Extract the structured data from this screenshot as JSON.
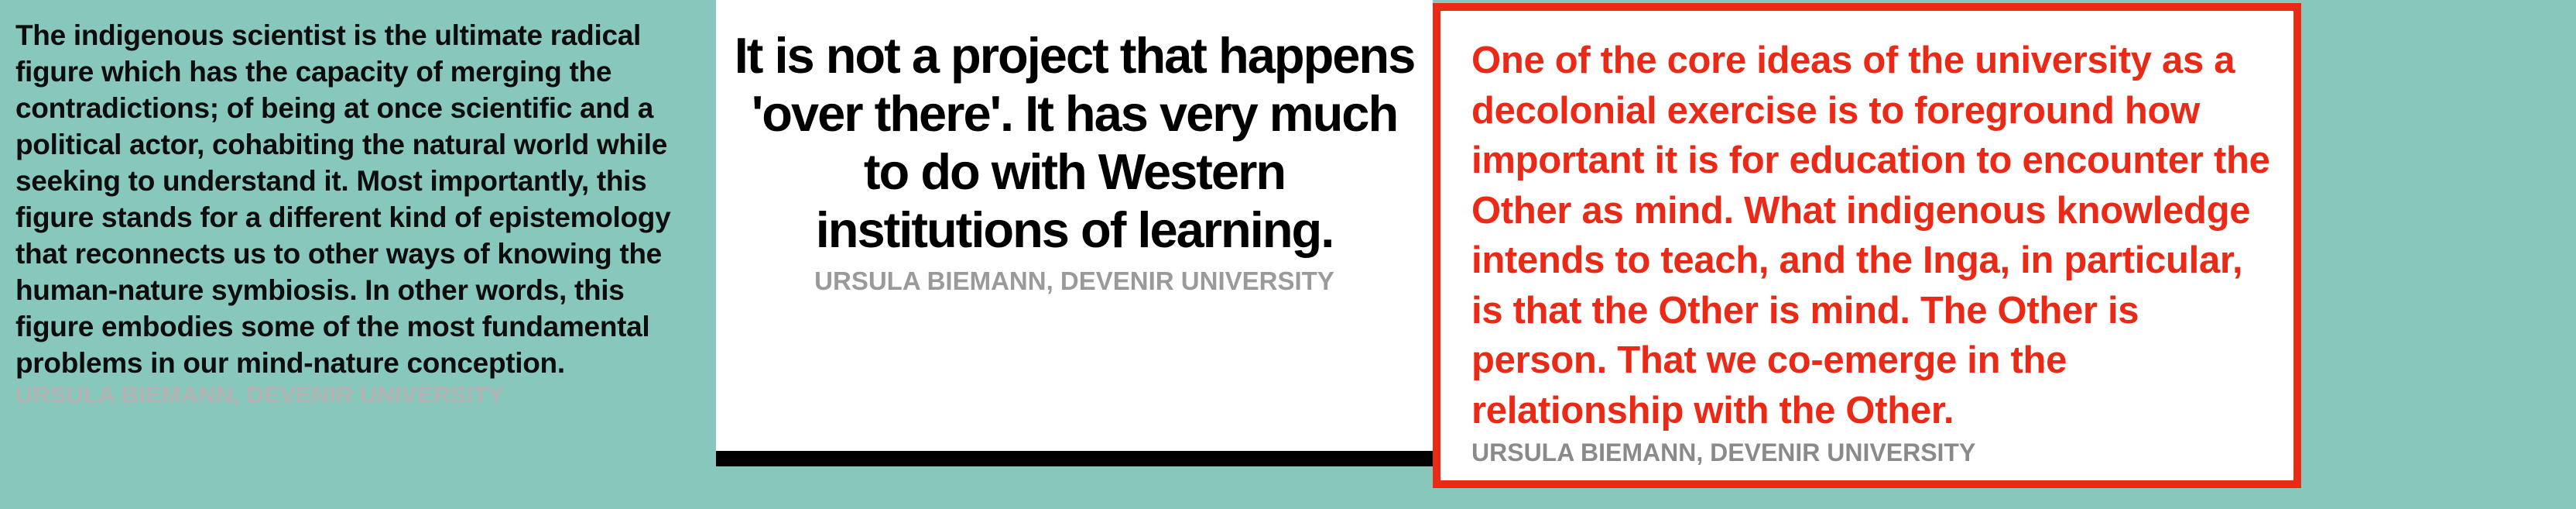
{
  "background_color": "#88c7bc",
  "cards": [
    {
      "quote": "The indigenous scientist is the ultimate radical figure which has the capacity of merging the contradictions; of being at once scientific and a political actor, cohabiting the natural world while seeking to understand it. Most importantly, this figure stands for a different kind of epistemology that reconnects us to other ways of knowing the human-nature symbiosis. In other words, this figure embodies some of the most fundamental problems in our mind-nature conception.",
      "attribution": "URSULA BIEMANN, DEVENIR UNIVERSITY",
      "background_color": "#88c7bc",
      "text_color": "#0d0d0d",
      "attribution_color": "#b3b3b3"
    },
    {
      "quote": "It is not a project that happens 'over there'. It has very much to do with Western institutions of learning.",
      "attribution": "URSULA BIEMANN, DEVENIR UNIVERSITY",
      "background_color": "#ffffff",
      "border_color": "#000000",
      "text_color": "#000000",
      "attribution_color": "#9a9a9a"
    },
    {
      "quote": "One of the core ideas of the university as a decolonial exercise is to foreground how important it is for education to encounter the Other as mind. What indigenous knowledge intends to teach, and the Inga, in particular, is that the Other is mind. The Other is person. That we co-emerge in the relationship with the Other.",
      "attribution": "URSULA BIEMANN, DEVENIR UNIVERSITY",
      "background_color": "#ffffff",
      "border_color": "#ea2a16",
      "text_color": "#ea2a16",
      "attribution_color": "#8a8a8a"
    }
  ]
}
